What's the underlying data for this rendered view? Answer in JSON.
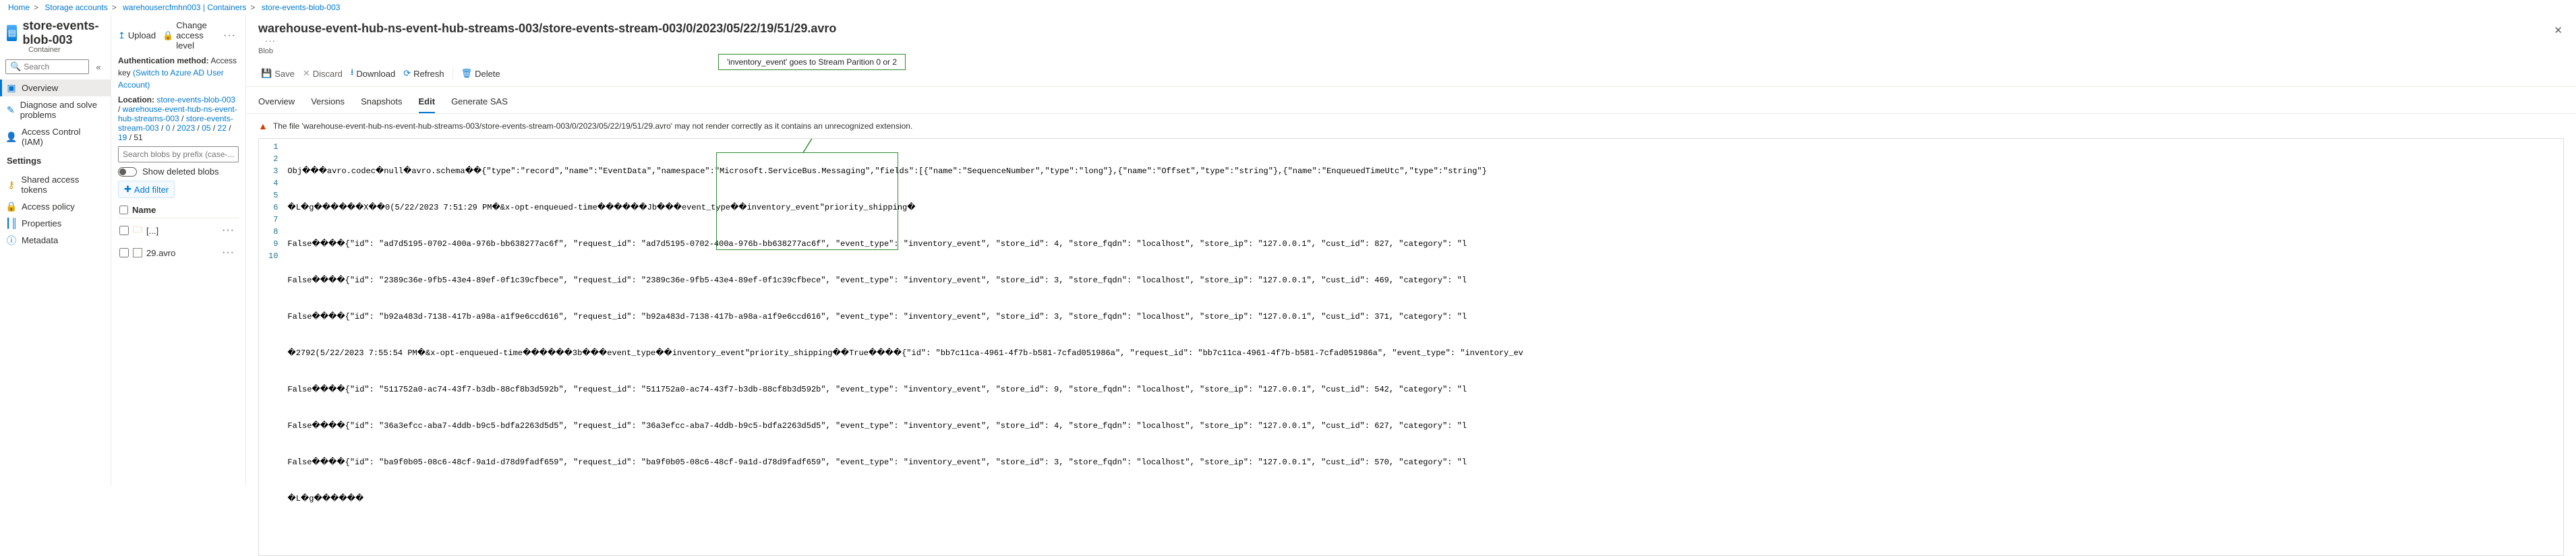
{
  "breadcrumb": [
    "Home",
    "Storage accounts",
    "warehousercfmhn003 | Containers",
    "store-events-blob-003"
  ],
  "resource": {
    "title": "store-events-blob-003",
    "subtitle": "Container",
    "search_placeholder": "Search",
    "nav_overview": "Overview",
    "nav_diagnose": "Diagnose and solve problems",
    "nav_iam": "Access Control (IAM)",
    "settings_head": "Settings",
    "nav_sas": "Shared access tokens",
    "nav_policy": "Access policy",
    "nav_properties": "Properties",
    "nav_metadata": "Metadata"
  },
  "blob_panel": {
    "upload": "Upload",
    "change_access": "Change access level",
    "auth_label": "Authentication method:",
    "auth_value": "Access key",
    "auth_switch": "(Switch to Azure AD User Account)",
    "loc_label": "Location:",
    "loc_parts": [
      "store-events-blob-003",
      "warehouse-event-hub-ns-event-hub-streams-003",
      "store-events-stream-003",
      "0",
      "2023",
      "05",
      "22",
      "19",
      "51"
    ],
    "prefix_placeholder": "Search blobs by prefix (case-...",
    "show_deleted": "Show deleted blobs",
    "add_filter": "Add filter",
    "col_name": "Name",
    "row_up": "[...]",
    "row_file": "29.avro"
  },
  "detail": {
    "title": "warehouse-event-hub-ns-event-hub-streams-003/store-events-stream-003/0/2023/05/22/19/51/29.avro",
    "subtitle": "Blob",
    "btn_save": "Save",
    "btn_discard": "Discard",
    "btn_download": "Download",
    "btn_refresh": "Refresh",
    "btn_delete": "Delete",
    "callout": "'inventory_event' goes to Stream Parition 0 or 2",
    "tab_overview": "Overview",
    "tab_versions": "Versions",
    "tab_snapshots": "Snapshots",
    "tab_edit": "Edit",
    "tab_sas": "Generate SAS",
    "warn": "The file 'warehouse-event-hub-ns-event-hub-streams-003/store-events-stream-003/0/2023/05/22/19/51/29.avro' may not render correctly as it contains an unrecognized extension.",
    "lines": [
      "Obj���avro.codec�null�avro.schema��{\"type\":\"record\",\"name\":\"EventData\",\"namespace\":\"Microsoft.ServiceBus.Messaging\",\"fields\":[{\"name\":\"SequenceNumber\",\"type\":\"long\"},{\"name\":\"Offset\",\"type\":\"string\"},{\"name\":\"EnqueuedTimeUtc\",\"type\":\"string\"}",
      "�L�g������X��0(5/22/2023 7:51:29 PM�&x-opt-enqueued-time������Jb���event_type��inventory_event\"priority_shipping�",
      "False����{\"id\": \"ad7d5195-0702-400a-976b-bb638277ac6f\", \"request_id\": \"ad7d5195-0702-400a-976b-bb638277ac6f\", \"event_type\": \"inventory_event\", \"store_id\": 4, \"store_fqdn\": \"localhost\", \"store_ip\": \"127.0.0.1\", \"cust_id\": 827, \"category\": \"l",
      "False����{\"id\": \"2389c36e-9fb5-43e4-89ef-0f1c39cfbece\", \"request_id\": \"2389c36e-9fb5-43e4-89ef-0f1c39cfbece\", \"event_type\": \"inventory_event\", \"store_id\": 3, \"store_fqdn\": \"localhost\", \"store_ip\": \"127.0.0.1\", \"cust_id\": 469, \"category\": \"l",
      "False����{\"id\": \"b92a483d-7138-417b-a98a-a1f9e6ccd616\", \"request_id\": \"b92a483d-7138-417b-a98a-a1f9e6ccd616\", \"event_type\": \"inventory_event\", \"store_id\": 3, \"store_fqdn\": \"localhost\", \"store_ip\": \"127.0.0.1\", \"cust_id\": 371, \"category\": \"l",
      "�2792(5/22/2023 7:55:54 PM�&x-opt-enqueued-time������3b���event_type��inventory_event\"priority_shipping��True����{\"id\": \"bb7c11ca-4961-4f7b-b581-7cfad051986a\", \"request_id\": \"bb7c11ca-4961-4f7b-b581-7cfad051986a\", \"event_type\": \"inventory_ev",
      "False����{\"id\": \"511752a0-ac74-43f7-b3db-88cf8b3d592b\", \"request_id\": \"511752a0-ac74-43f7-b3db-88cf8b3d592b\", \"event_type\": \"inventory_event\", \"store_id\": 9, \"store_fqdn\": \"localhost\", \"store_ip\": \"127.0.0.1\", \"cust_id\": 542, \"category\": \"l",
      "False����{\"id\": \"36a3efcc-aba7-4ddb-b9c5-bdfa2263d5d5\", \"request_id\": \"36a3efcc-aba7-4ddb-b9c5-bdfa2263d5d5\", \"event_type\": \"inventory_event\", \"store_id\": 4, \"store_fqdn\": \"localhost\", \"store_ip\": \"127.0.0.1\", \"cust_id\": 627, \"category\": \"l",
      "False����{\"id\": \"ba9f0b05-08c6-48cf-9a1d-d78d9fadf659\", \"request_id\": \"ba9f0b05-08c6-48cf-9a1d-d78d9fadf659\", \"event_type\": \"inventory_event\", \"store_id\": 3, \"store_fqdn\": \"localhost\", \"store_ip\": \"127.0.0.1\", \"cust_id\": 570, \"category\": \"l",
      "�L�g������"
    ]
  }
}
